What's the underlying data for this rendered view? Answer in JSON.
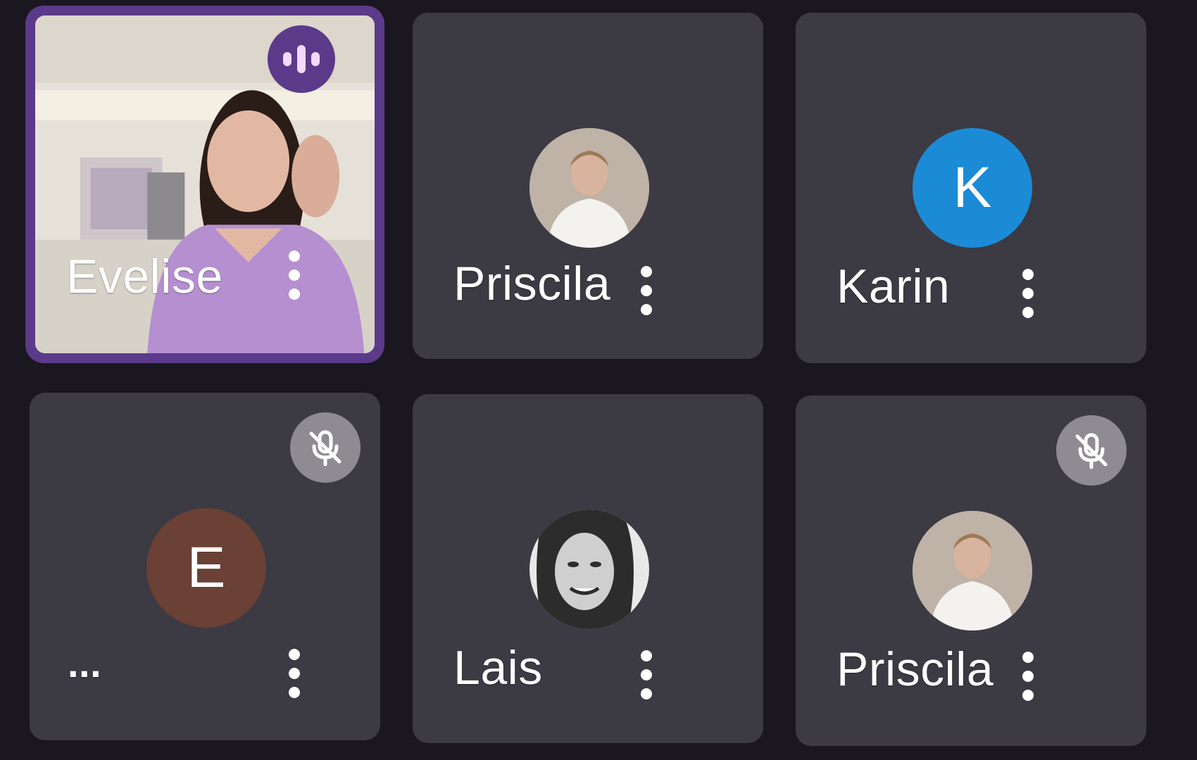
{
  "participants": [
    {
      "name": "Evelise",
      "video_on": true,
      "speaking": true
    },
    {
      "name": "Priscila",
      "avatar_type": "photo"
    },
    {
      "name": "Karin",
      "avatar_type": "initial",
      "initial": "K",
      "avatar_color": "#1b8bd6"
    },
    {
      "name": "...",
      "avatar_type": "initial",
      "initial": "E",
      "avatar_color": "#6b4035",
      "muted": true
    },
    {
      "name": "Lais",
      "avatar_type": "photo"
    },
    {
      "name": "Priscila",
      "avatar_type": "photo",
      "muted": true
    }
  ],
  "icons": {
    "speaking": "audio-wave-icon",
    "muted": "mic-off-icon",
    "more": "more-vert-icon"
  },
  "colors": {
    "background": "#1a1720",
    "tile": "#3c3a43",
    "active_border": "#5b3a8a",
    "muted_badge": "#8e8b92"
  }
}
